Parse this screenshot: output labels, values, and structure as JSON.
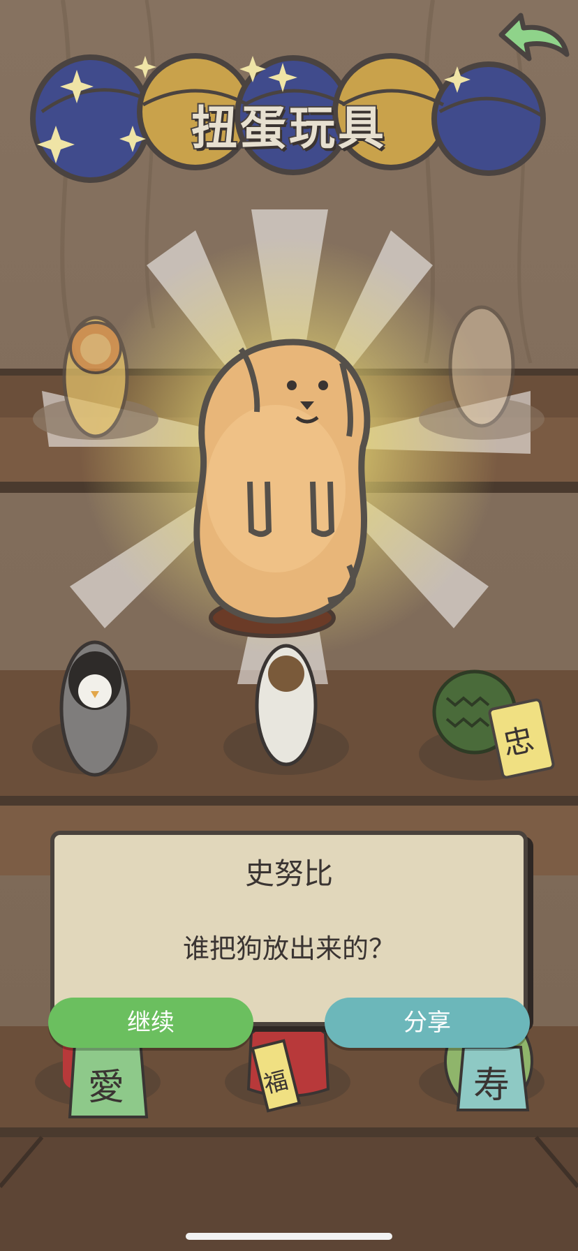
{
  "header": {
    "title": "扭蛋玩具"
  },
  "shelf_tags": {
    "durian_tag": "忠",
    "left_tag": "愛",
    "middle_tag": "福",
    "right_tag": "寿"
  },
  "dialog": {
    "title": "史努比",
    "message": "谁把狗放出来的？"
  },
  "buttons": {
    "continue_label": "继续",
    "share_label": "分享"
  },
  "icons": [
    "back-arrow-icon",
    "sparkle-icon"
  ],
  "colors": {
    "continue": "#6bbf5f",
    "share": "#6cb7ba",
    "dialog_bg": "#e1d7bb",
    "back_arrow": "#8fd38a"
  }
}
